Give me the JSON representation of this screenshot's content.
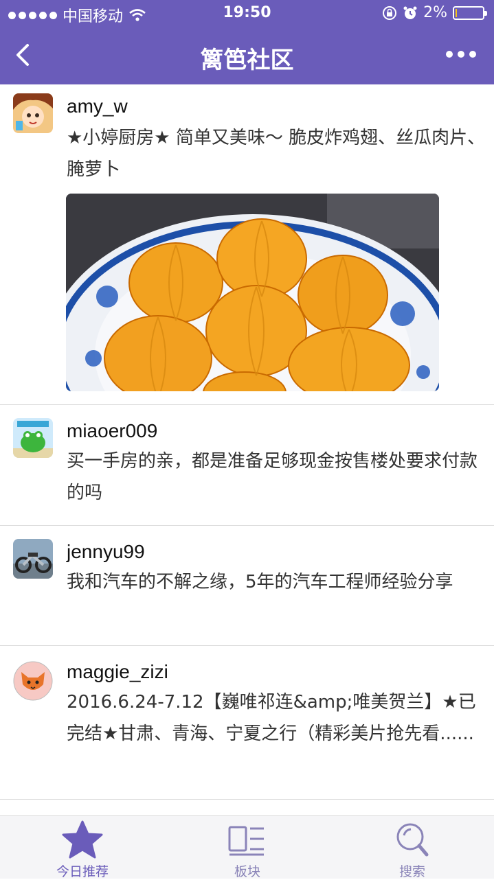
{
  "status_bar": {
    "carrier": "中国移动",
    "time": "19:50",
    "battery": "2%",
    "battery_level": 0.02
  },
  "nav": {
    "title": "篱笆社区"
  },
  "posts": [
    {
      "username": "amy_w",
      "title": "★小婷厨房★ 简单又美味～ 脆皮炸鸡翅、丝瓜肉片、腌萝卜"
    },
    {
      "username": "miaoer009",
      "title": "买一手房的亲，都是准备足够现金按售楼处要求付款的吗"
    },
    {
      "username": "jennyu99",
      "title": "我和汽车的不解之缘，5年的汽车工程师经验分享"
    },
    {
      "username": "maggie_zizi",
      "title": "2016.6.24-7.12【巍唯祁连&amp;唯美贺兰】★已完结★甘肃、青海、宁夏之行（精彩美片抢先看......"
    }
  ],
  "tabs": [
    {
      "label": "今日推荐",
      "icon": "star-icon",
      "active": true
    },
    {
      "label": "板块",
      "icon": "board-list-icon",
      "active": false
    },
    {
      "label": "搜索",
      "icon": "search-icon",
      "active": false
    }
  ],
  "colors": {
    "brand": "#6A5CBA",
    "tab_inactive": "#8a84b8"
  }
}
